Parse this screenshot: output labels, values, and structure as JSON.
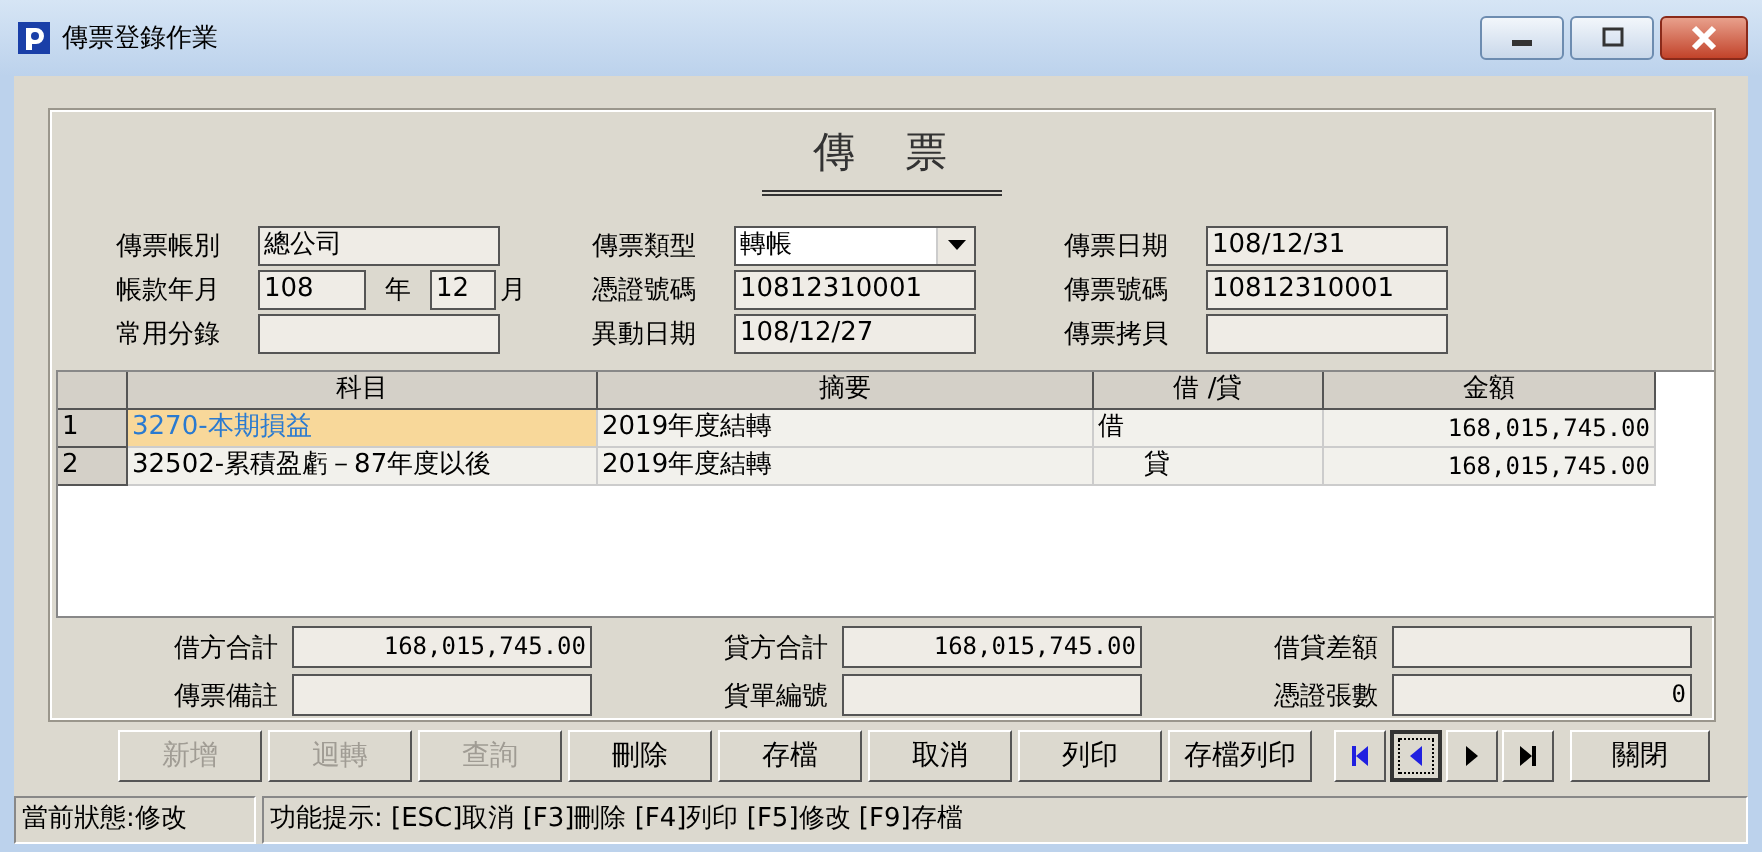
{
  "window": {
    "title": "傳票登錄作業"
  },
  "form_title": "傳　票",
  "fields": [
    {
      "label": "傳票帳別",
      "value": "總公司",
      "kind": "text"
    },
    {
      "label": "傳票類型",
      "value": "轉帳",
      "kind": "dropdown"
    },
    {
      "label": "傳票日期",
      "value": "108/12/31",
      "kind": "text"
    },
    {
      "label": "帳款年月",
      "value": "108",
      "unit": "年",
      "value_2": "12",
      "unit_2": "月",
      "kind": "yearmonth"
    },
    {
      "label": "憑證號碼",
      "value": "10812310001",
      "kind": "text"
    },
    {
      "label": "傳票號碼",
      "value": "10812310001",
      "kind": "text"
    },
    {
      "label": "常用分錄",
      "kind": "text"
    },
    {
      "label": "異動日期",
      "value": "108/12/27",
      "kind": "text"
    },
    {
      "label": "傳票拷貝",
      "kind": "text"
    }
  ],
  "table": {
    "columns": [
      "科目",
      "摘要",
      "借 /貸",
      "金額"
    ],
    "rows": [
      {
        "index": "1",
        "account": "3270-本期損益",
        "summary": "2019年度結轉",
        "side": "借",
        "side_indented": false,
        "amount": "168,015,745.00",
        "selected": true
      },
      {
        "index": "2",
        "account": "32502-累積盈虧－87年度以後",
        "summary": "2019年度結轉",
        "side": "貸",
        "side_indented": true,
        "amount": "168,015,745.00",
        "selected": false
      }
    ]
  },
  "totals": [
    {
      "label": "借方合計",
      "value": "168,015,745.00"
    },
    {
      "label": "貸方合計",
      "value": "168,015,745.00"
    },
    {
      "label": "借貸差額"
    },
    {
      "label": "傳票備註"
    },
    {
      "label": "貨單編號"
    },
    {
      "label": "憑證張數",
      "value": "0"
    }
  ],
  "buttons": [
    {
      "label": "新增",
      "disabled": true
    },
    {
      "label": "迴轉",
      "disabled": true
    },
    {
      "label": "查詢",
      "disabled": true
    },
    {
      "label": "刪除",
      "disabled": false
    },
    {
      "label": "存檔",
      "disabled": false
    },
    {
      "label": "取消",
      "disabled": false
    },
    {
      "label": "列印",
      "disabled": false
    },
    {
      "label": "存檔列印",
      "disabled": false
    }
  ],
  "nav_buttons": [
    {
      "kind": "first",
      "selected": false
    },
    {
      "kind": "prev",
      "selected": true
    },
    {
      "kind": "next",
      "selected": false
    },
    {
      "kind": "last",
      "selected": false
    }
  ],
  "close_button": "關閉",
  "status_bar": {
    "state": "當前狀態:修改",
    "hint": "功能提示: [ESC]取消 [F3]刪除 [F4]列印 [F5]修改 [F9]存檔"
  }
}
